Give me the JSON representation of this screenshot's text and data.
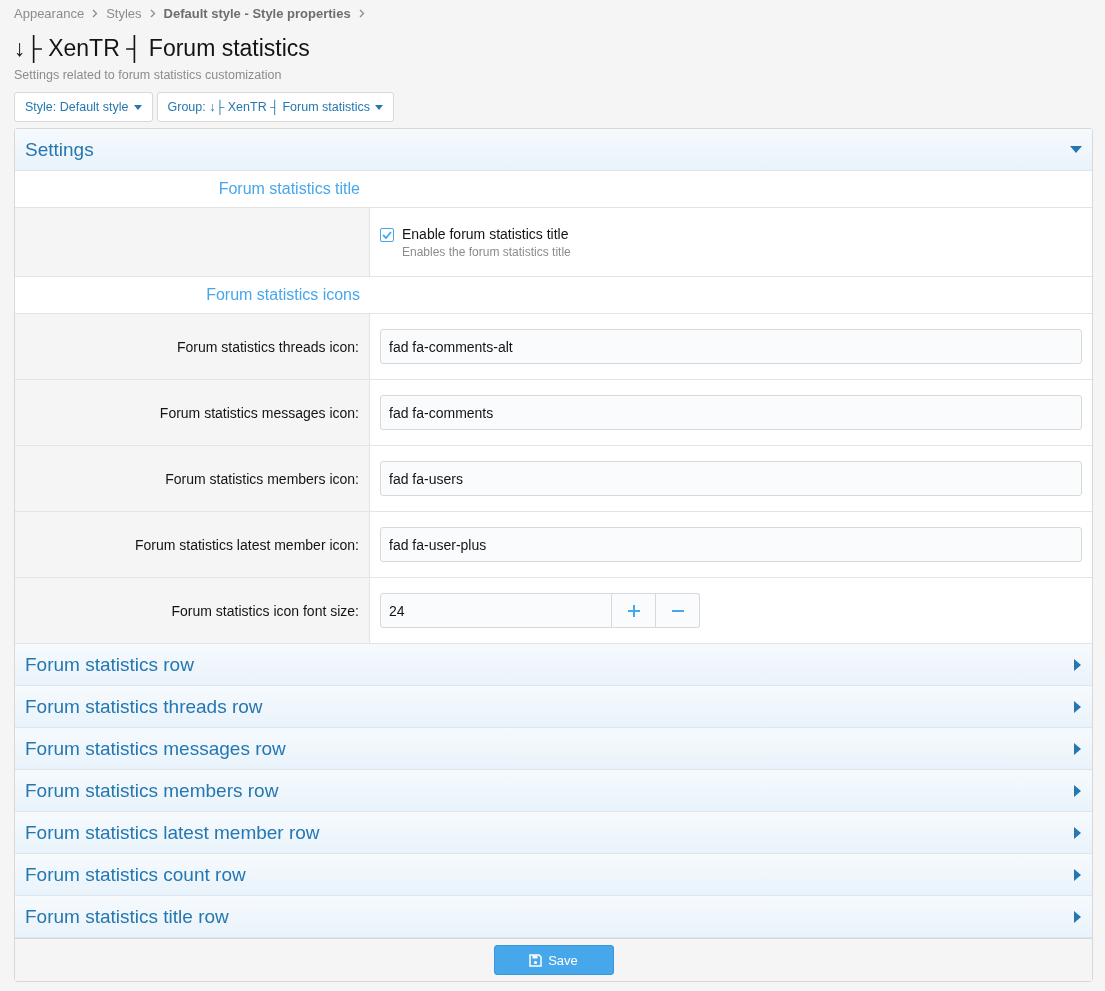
{
  "breadcrumbs": [
    {
      "label": "Appearance",
      "current": false
    },
    {
      "label": "Styles",
      "current": false
    },
    {
      "label": "Default style - Style properties",
      "current": true
    }
  ],
  "title": "↓├ XenTR ┤ Forum statistics",
  "description": "Settings related to forum statistics customization",
  "filters": [
    "Style: Default style",
    "Group: ↓├ XenTR ┤ Forum statistics"
  ],
  "settings": {
    "title": "Settings",
    "expanded": true,
    "sections": [
      {
        "heading": "Forum statistics title",
        "rows": [
          {
            "kind": "checkbox",
            "label": "Enable forum statistics title",
            "hint": "Enables the forum statistics title",
            "checked": true
          }
        ]
      },
      {
        "heading": "Forum statistics icons",
        "rows": [
          {
            "kind": "text",
            "label": "Forum statistics threads icon:",
            "value": "fad fa-comments-alt"
          },
          {
            "kind": "text",
            "label": "Forum statistics messages icon:",
            "value": "fad fa-comments"
          },
          {
            "kind": "text",
            "label": "Forum statistics members icon:",
            "value": "fad fa-users"
          },
          {
            "kind": "text",
            "label": "Forum statistics latest member icon:",
            "value": "fad fa-user-plus"
          },
          {
            "kind": "number",
            "label": "Forum statistics icon font size:",
            "value": "24"
          }
        ]
      }
    ]
  },
  "groups": [
    {
      "title": "Forum statistics row",
      "expanded": false
    },
    {
      "title": "Forum statistics threads row",
      "expanded": false
    },
    {
      "title": "Forum statistics messages row",
      "expanded": false
    },
    {
      "title": "Forum statistics members row",
      "expanded": false
    },
    {
      "title": "Forum statistics latest member row",
      "expanded": false
    },
    {
      "title": "Forum statistics count row",
      "expanded": false
    },
    {
      "title": "Forum statistics title row",
      "expanded": false
    }
  ],
  "save_button": "Save"
}
